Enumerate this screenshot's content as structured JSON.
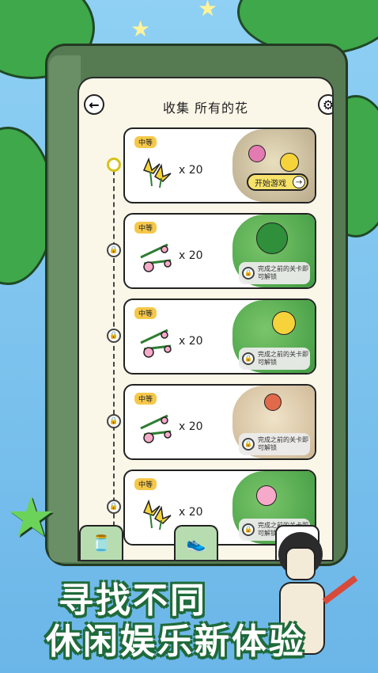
{
  "header": {
    "title": "收集 所有的花"
  },
  "levels": [
    {
      "difficulty": "中等",
      "count": "x 20",
      "flower": "yellow-flower",
      "status": "current",
      "action": "开始游戏"
    },
    {
      "difficulty": "中等",
      "count": "x 20",
      "flower": "pink-flower",
      "status": "locked",
      "lock_text": "完成之前的关卡即可解锁"
    },
    {
      "difficulty": "中等",
      "count": "x 20",
      "flower": "pink-flower",
      "status": "locked",
      "lock_text": "完成之前的关卡即可解锁"
    },
    {
      "difficulty": "中等",
      "count": "x 20",
      "flower": "pink-flower",
      "status": "locked",
      "lock_text": "完成之前的关卡即可解锁"
    },
    {
      "difficulty": "中等",
      "count": "x 20",
      "flower": "yellow-flower",
      "status": "locked",
      "lock_text": "完成之前的关卡即可解锁"
    }
  ],
  "slogan": {
    "line1": "寻找不同",
    "line2": "休闲娱乐新体验"
  },
  "colors": {
    "accent_yellow": "#f8e36a",
    "difficulty_badge": "#f5c84a",
    "frame_green": "#567a52",
    "slogan_outline": "#1f6a3a"
  }
}
